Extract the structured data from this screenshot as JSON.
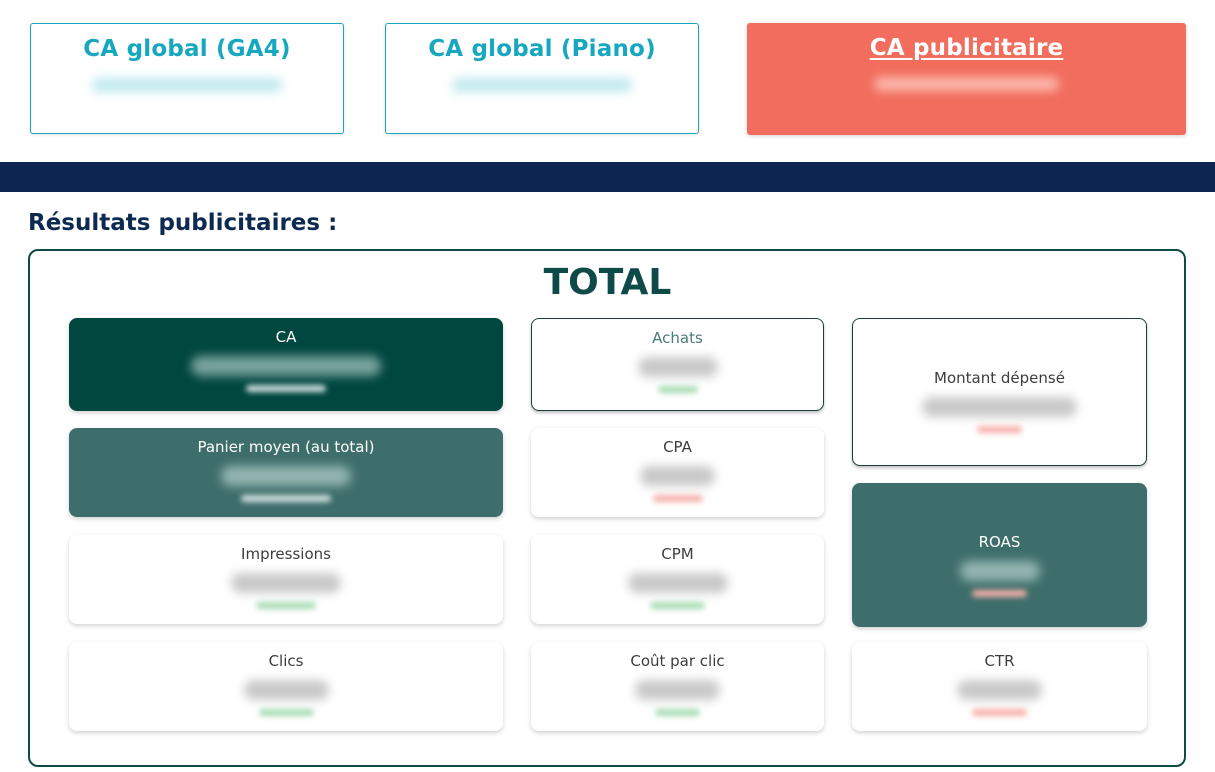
{
  "tabs": [
    {
      "id": "ga4",
      "label": "CA global (GA4)"
    },
    {
      "id": "piano",
      "label": "CA global (Piano)"
    },
    {
      "id": "pub",
      "label": "CA publicitaire"
    }
  ],
  "section": {
    "title": "Résultats publicitaires :"
  },
  "total": {
    "title": "TOTAL"
  },
  "kpis": [
    {
      "id": "ca",
      "label": "CA"
    },
    {
      "id": "achats",
      "label": "Achats"
    },
    {
      "id": "montant",
      "label": "Montant dépensé"
    },
    {
      "id": "panier",
      "label": "Panier moyen (au total)"
    },
    {
      "id": "cpa",
      "label": "CPA"
    },
    {
      "id": "roas",
      "label": "ROAS"
    },
    {
      "id": "impressions",
      "label": "Impressions"
    },
    {
      "id": "cpm",
      "label": "CPM"
    },
    {
      "id": "clics",
      "label": "Clics"
    },
    {
      "id": "cpc",
      "label": "Coût par clic"
    },
    {
      "id": "ctr",
      "label": "CTR"
    }
  ],
  "colors": {
    "accent": "#17a8c0",
    "active_tab": "#f26d5d",
    "navy": "#0c2550",
    "dark_green": "#00473f",
    "teal": "#3e6e6b"
  }
}
